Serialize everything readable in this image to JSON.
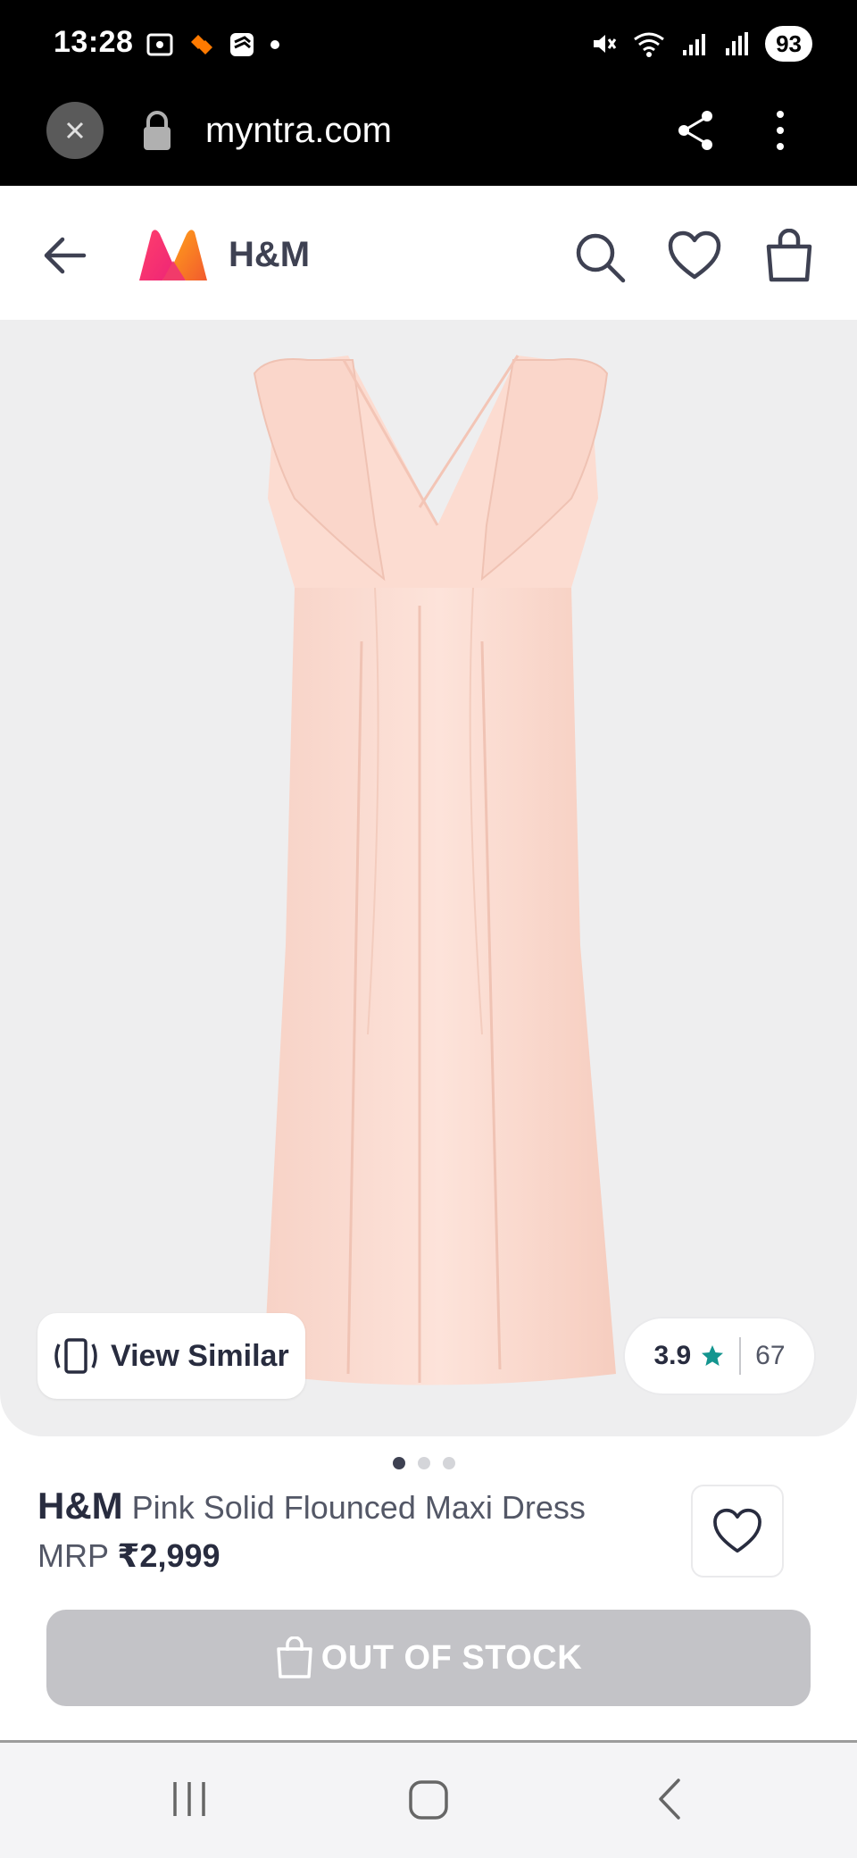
{
  "status_bar": {
    "time": "13:28",
    "battery": "93"
  },
  "browser": {
    "url": "myntra.com"
  },
  "header": {
    "brand": "H&M"
  },
  "product": {
    "view_similar_label": "View Similar",
    "rating": "3.9",
    "rating_count": "67",
    "brand": "H&M",
    "name": "Pink Solid Flounced Maxi Dress",
    "mrp_label": "MRP",
    "price": "₹2,999",
    "image_count": 3,
    "active_image_index": 0
  },
  "actions": {
    "out_of_stock_label": "OUT OF STOCK"
  },
  "colors": {
    "accent_pink": "#ff3f6c",
    "rating_star": "#14958f",
    "disabled_button": "#c3c3c7",
    "dress": "#fbdcd2"
  }
}
